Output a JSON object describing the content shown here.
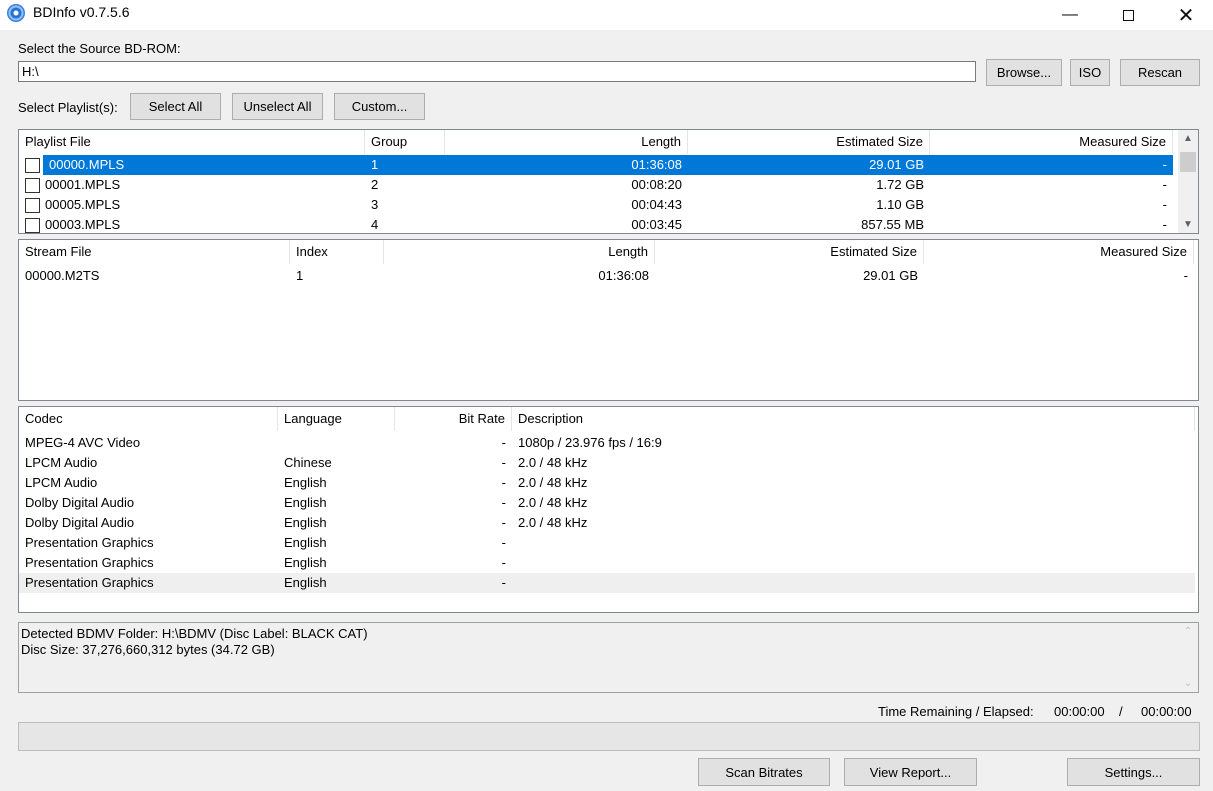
{
  "window": {
    "title": "BDInfo v0.7.5.6"
  },
  "source": {
    "label": "Select the Source BD-ROM:",
    "path": "H:\\",
    "browse": "Browse...",
    "iso": "ISO",
    "rescan": "Rescan"
  },
  "playlist_controls": {
    "label": "Select Playlist(s):",
    "select_all": "Select All",
    "unselect_all": "Unselect All",
    "custom": "Custom..."
  },
  "playlists": {
    "headers": [
      "Playlist File",
      "Group",
      "Length",
      "Estimated Size",
      "Measured Size"
    ],
    "rows": [
      {
        "file": "00000.MPLS",
        "group": "1",
        "length": "01:36:08",
        "est": "29.01 GB",
        "measured": "-",
        "selected": true
      },
      {
        "file": "00001.MPLS",
        "group": "2",
        "length": "00:08:20",
        "est": "1.72 GB",
        "measured": "-"
      },
      {
        "file": "00005.MPLS",
        "group": "3",
        "length": "00:04:43",
        "est": "1.10 GB",
        "measured": "-"
      },
      {
        "file": "00003.MPLS",
        "group": "4",
        "length": "00:03:45",
        "est": "857.55 MB",
        "measured": "-"
      }
    ]
  },
  "streams": {
    "headers": [
      "Stream File",
      "Index",
      "Length",
      "Estimated Size",
      "Measured Size"
    ],
    "rows": [
      {
        "file": "00000.M2TS",
        "index": "1",
        "length": "01:36:08",
        "est": "29.01 GB",
        "measured": "-"
      }
    ]
  },
  "codecs": {
    "headers": [
      "Codec",
      "Language",
      "Bit Rate",
      "Description"
    ],
    "rows": [
      {
        "codec": "MPEG-4 AVC Video",
        "language": "",
        "bitrate": "-",
        "desc": "1080p / 23.976 fps / 16:9"
      },
      {
        "codec": "LPCM Audio",
        "language": "Chinese",
        "bitrate": "-",
        "desc": "2.0 / 48 kHz"
      },
      {
        "codec": "LPCM Audio",
        "language": "English",
        "bitrate": "-",
        "desc": "2.0 / 48 kHz"
      },
      {
        "codec": "Dolby Digital Audio",
        "language": "English",
        "bitrate": "-",
        "desc": "2.0 / 48 kHz"
      },
      {
        "codec": "Dolby Digital Audio",
        "language": "English",
        "bitrate": "-",
        "desc": "2.0 / 48 kHz"
      },
      {
        "codec": "Presentation Graphics",
        "language": "English",
        "bitrate": "-",
        "desc": ""
      },
      {
        "codec": "Presentation Graphics",
        "language": "English",
        "bitrate": "-",
        "desc": ""
      },
      {
        "codec": "Presentation Graphics",
        "language": "English",
        "bitrate": "-",
        "desc": "",
        "hover": true
      }
    ]
  },
  "info": {
    "line1": "Detected BDMV Folder: H:\\BDMV (Disc Label: BLACK CAT)",
    "line2": "Disc Size: 37,276,660,312 bytes (34.72 GB)"
  },
  "status": {
    "label": "Time Remaining / Elapsed:",
    "remaining": "00:00:00",
    "separator": "/",
    "elapsed": "00:00:00"
  },
  "progress": {
    "percent": 0
  },
  "footer": {
    "scan": "Scan Bitrates",
    "report": "View Report...",
    "settings": "Settings..."
  },
  "colors": {
    "selection": "#0078d7",
    "hover_row": "#efefef"
  }
}
